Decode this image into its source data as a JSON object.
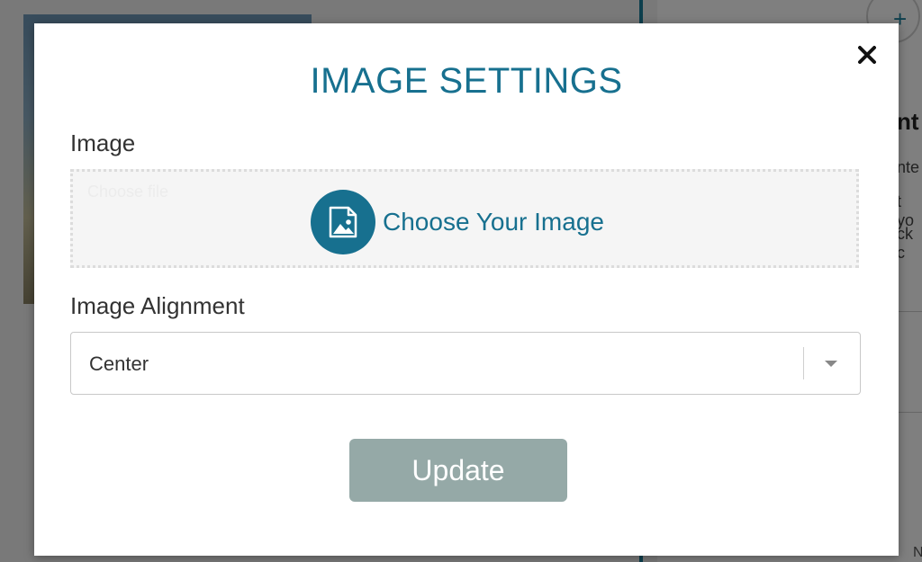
{
  "background": {
    "right_heading_fragment": "nt",
    "right_text_lines": [
      "nte",
      "t yo",
      "ck c"
    ],
    "bottom_fragment": "N"
  },
  "modal": {
    "title": "IMAGE SETTINGS",
    "image_label": "Image",
    "upload_ghost_text": "Choose file",
    "choose_image_label": "Choose Your Image",
    "alignment_label": "Image Alignment",
    "alignment_value": "Center",
    "update_label": "Update"
  },
  "colors": {
    "accent": "#17708f",
    "button_disabled": "#95a9a7"
  },
  "icons": {
    "close": "close-icon",
    "image": "image-file-icon",
    "dropdown": "caret-down-icon"
  }
}
